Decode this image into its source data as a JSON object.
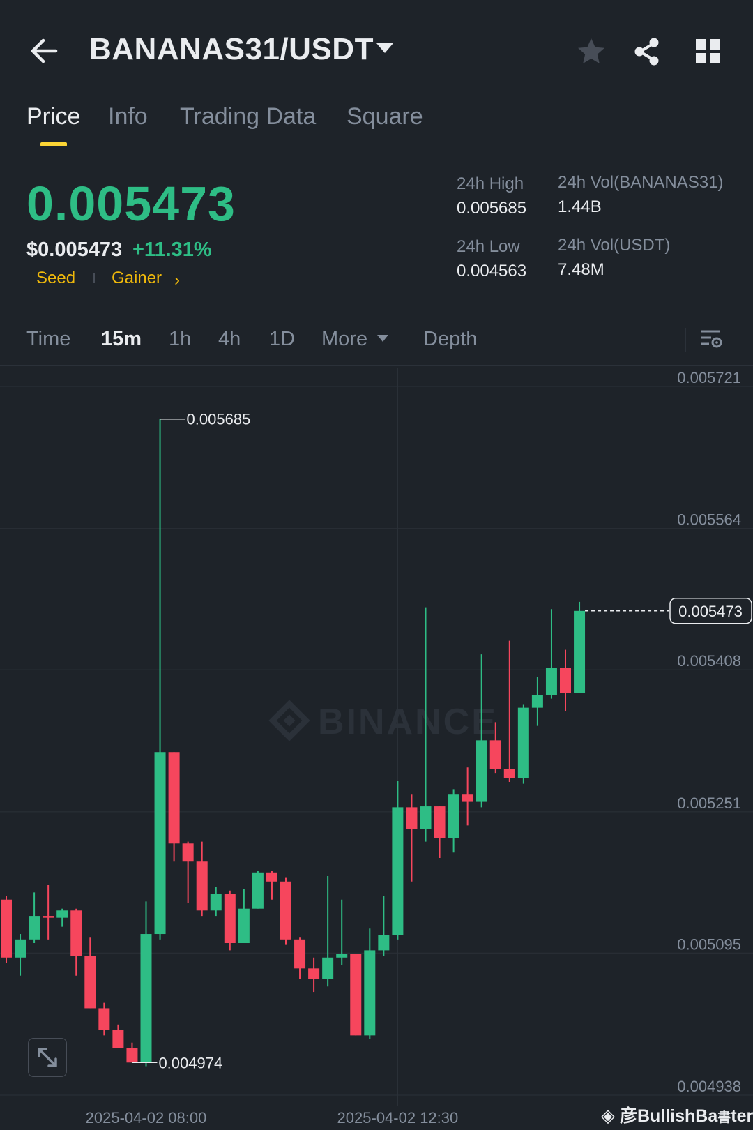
{
  "header": {
    "pair": "BANANAS31/USDT",
    "icons": [
      "back-arrow-icon",
      "caret-down-icon",
      "star-icon",
      "share-icon",
      "grid-icon"
    ]
  },
  "tabs": [
    {
      "label": "Price",
      "active": true
    },
    {
      "label": "Info",
      "active": false
    },
    {
      "label": "Trading Data",
      "active": false
    },
    {
      "label": "Square",
      "active": false
    }
  ],
  "ticker": {
    "last_price": "0.005473",
    "usd_price": "$0.005473",
    "change_pct": "+11.31%",
    "tags": [
      "Seed",
      "Gainer"
    ],
    "stats": {
      "high_label": "24h High",
      "high_value": "0.005685",
      "low_label": "24h Low",
      "low_value": "0.004563",
      "vol_base_label": "24h Vol(BANANAS31)",
      "vol_base_value": "1.44B",
      "vol_quote_label": "24h Vol(USDT)",
      "vol_quote_value": "7.48M"
    }
  },
  "intervals": {
    "items": [
      "Time",
      "15m",
      "1h",
      "4h",
      "1D",
      "More",
      "Depth"
    ],
    "active": "15m"
  },
  "colors": {
    "up": "#2ebd85",
    "down": "#f6465d",
    "accent": "#fcd535",
    "background": "#1e2329"
  },
  "chart_data": {
    "type": "candlestick",
    "interval": "15m",
    "y_ticks": [
      "0.005721",
      "0.005564",
      "0.005408",
      "0.005251",
      "0.005095",
      "0.004938"
    ],
    "y_tick_values": [
      0.005721,
      0.005564,
      0.005408,
      0.005251,
      0.005095,
      0.004938
    ],
    "x_labels": [
      {
        "label": "2025-04-02 08:00",
        "candle_index": 10
      },
      {
        "label": "2025-04-02 12:30",
        "candle_index": 28
      }
    ],
    "current_price_label": "0.005473",
    "high_marker": {
      "label": "0.005685",
      "candle_index": 11
    },
    "low_marker": {
      "label": "0.004974",
      "candle_index": 9
    },
    "candles": [
      {
        "o": 5154,
        "h": 5158,
        "l": 5084,
        "c": 5090
      },
      {
        "o": 5090,
        "h": 5116,
        "l": 5070,
        "c": 5110
      },
      {
        "o": 5110,
        "h": 5162,
        "l": 5106,
        "c": 5136
      },
      {
        "o": 5136,
        "h": 5170,
        "l": 5110,
        "c": 5134
      },
      {
        "o": 5134,
        "h": 5144,
        "l": 5124,
        "c": 5142
      },
      {
        "o": 5142,
        "h": 5144,
        "l": 5070,
        "c": 5092
      },
      {
        "o": 5092,
        "h": 5112,
        "l": 5034,
        "c": 5034
      },
      {
        "o": 5034,
        "h": 5040,
        "l": 5004,
        "c": 5010
      },
      {
        "o": 5010,
        "h": 5016,
        "l": 4990,
        "c": 4990
      },
      {
        "o": 4990,
        "h": 4996,
        "l": 4974,
        "c": 4974
      },
      {
        "o": 4974,
        "h": 5152,
        "l": 4970,
        "c": 5116
      },
      {
        "o": 5116,
        "h": 5685,
        "l": 5110,
        "c": 5317
      },
      {
        "o": 5317,
        "h": 5317,
        "l": 5196,
        "c": 5216
      },
      {
        "o": 5216,
        "h": 5218,
        "l": 5150,
        "c": 5196
      },
      {
        "o": 5196,
        "h": 5218,
        "l": 5136,
        "c": 5142
      },
      {
        "o": 5142,
        "h": 5168,
        "l": 5136,
        "c": 5160
      },
      {
        "o": 5160,
        "h": 5164,
        "l": 5098,
        "c": 5106
      },
      {
        "o": 5106,
        "h": 5166,
        "l": 5106,
        "c": 5144
      },
      {
        "o": 5144,
        "h": 5186,
        "l": 5144,
        "c": 5184
      },
      {
        "o": 5184,
        "h": 5186,
        "l": 5154,
        "c": 5174
      },
      {
        "o": 5174,
        "h": 5178,
        "l": 5104,
        "c": 5110
      },
      {
        "o": 5110,
        "h": 5112,
        "l": 5066,
        "c": 5078
      },
      {
        "o": 5078,
        "h": 5090,
        "l": 5052,
        "c": 5066
      },
      {
        "o": 5066,
        "h": 5180,
        "l": 5058,
        "c": 5090
      },
      {
        "o": 5090,
        "h": 5154,
        "l": 5082,
        "c": 5094
      },
      {
        "o": 5094,
        "h": 5094,
        "l": 5004,
        "c": 5004
      },
      {
        "o": 5004,
        "h": 5122,
        "l": 5000,
        "c": 5098
      },
      {
        "o": 5098,
        "h": 5158,
        "l": 5092,
        "c": 5115
      },
      {
        "o": 5115,
        "h": 5285,
        "l": 5110,
        "c": 5256
      },
      {
        "o": 5256,
        "h": 5270,
        "l": 5174,
        "c": 5232
      },
      {
        "o": 5232,
        "h": 5477,
        "l": 5218,
        "c": 5257
      },
      {
        "o": 5257,
        "h": 5257,
        "l": 5200,
        "c": 5222
      },
      {
        "o": 5222,
        "h": 5276,
        "l": 5206,
        "c": 5270
      },
      {
        "o": 5270,
        "h": 5300,
        "l": 5236,
        "c": 5262
      },
      {
        "o": 5262,
        "h": 5425,
        "l": 5256,
        "c": 5330
      },
      {
        "o": 5330,
        "h": 5350,
        "l": 5294,
        "c": 5298
      },
      {
        "o": 5298,
        "h": 5440,
        "l": 5284,
        "c": 5288
      },
      {
        "o": 5288,
        "h": 5370,
        "l": 5282,
        "c": 5366
      },
      {
        "o": 5366,
        "h": 5400,
        "l": 5346,
        "c": 5380
      },
      {
        "o": 5380,
        "h": 5475,
        "l": 5376,
        "c": 5410
      },
      {
        "o": 5410,
        "h": 5430,
        "l": 5362,
        "c": 5382
      },
      {
        "o": 5382,
        "h": 5483,
        "l": 5382,
        "c": 5473
      }
    ]
  },
  "watermark": "彦BullishBa",
  "watermark_tail": "ter",
  "chart_brand": "BINANCE"
}
